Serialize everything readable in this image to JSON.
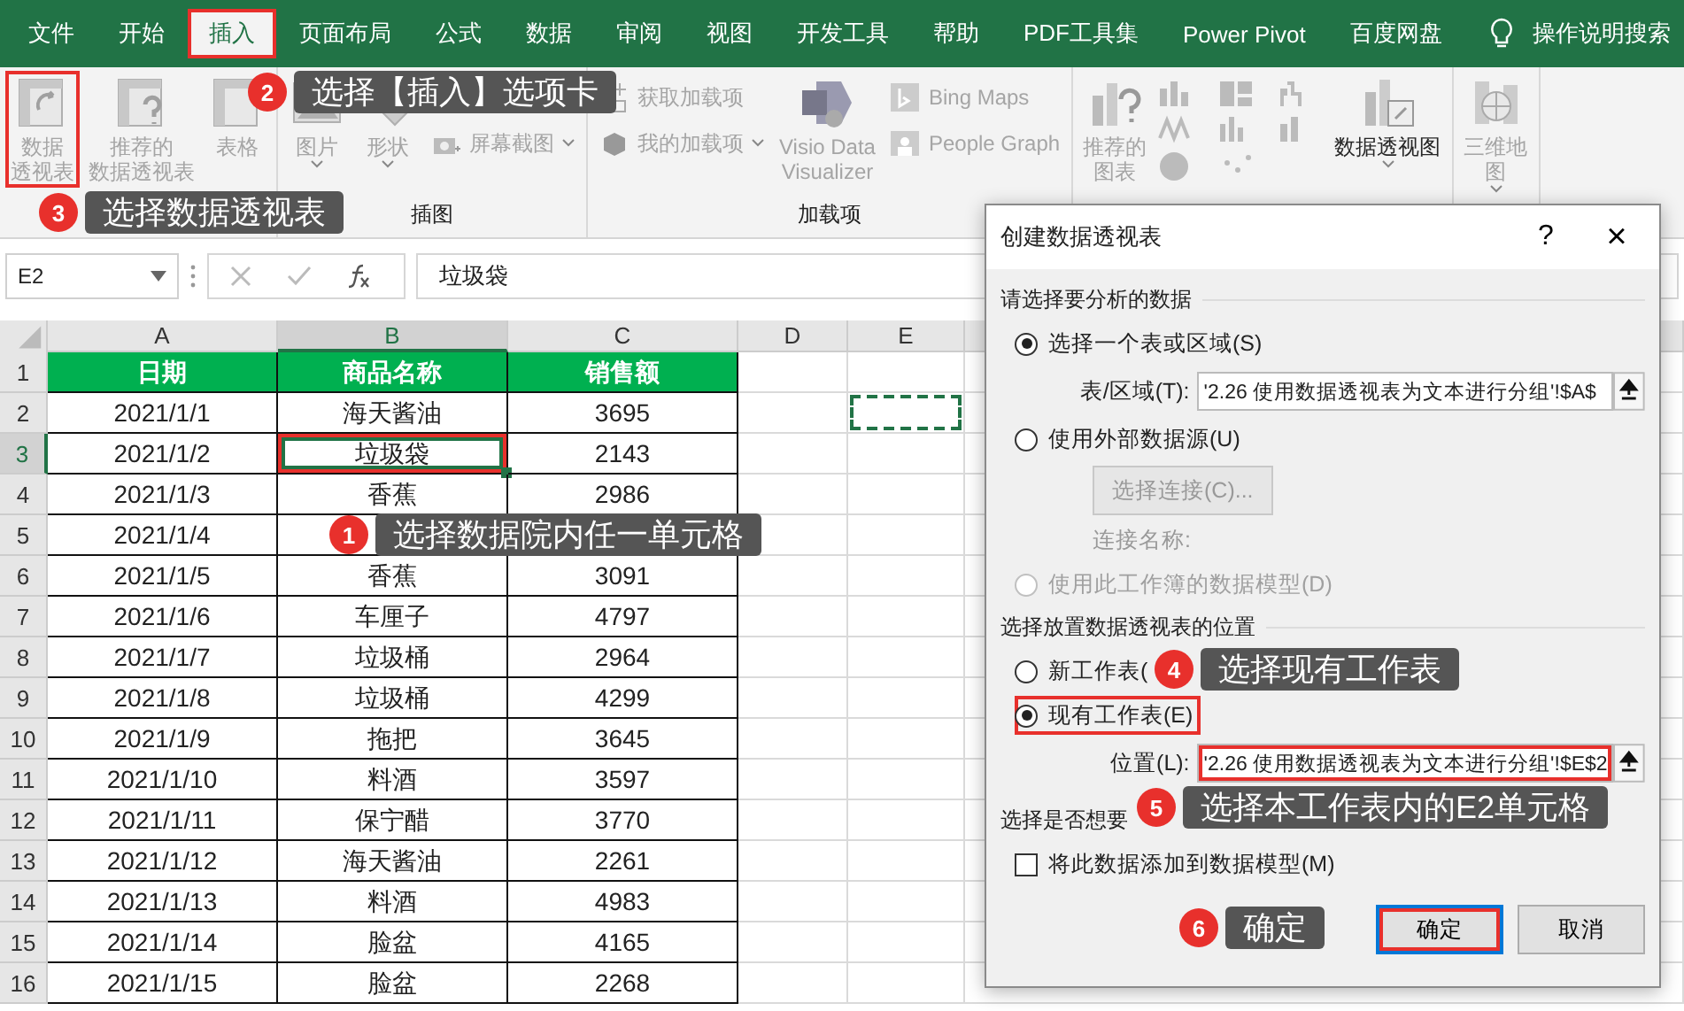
{
  "menu": {
    "tabs": [
      {
        "label": "文件",
        "selected": false
      },
      {
        "label": "开始",
        "selected": false
      },
      {
        "label": "插入",
        "selected": true,
        "highlighted": true
      },
      {
        "label": "页面布局",
        "selected": false
      },
      {
        "label": "公式",
        "selected": false
      },
      {
        "label": "数据",
        "selected": false
      },
      {
        "label": "审阅",
        "selected": false
      },
      {
        "label": "视图",
        "selected": false
      },
      {
        "label": "开发工具",
        "selected": false
      },
      {
        "label": "帮助",
        "selected": false
      },
      {
        "label": "PDF工具集",
        "selected": false
      },
      {
        "label": "Power Pivot",
        "selected": false
      },
      {
        "label": "百度网盘",
        "selected": false
      }
    ],
    "search": "操作说明搜索"
  },
  "ribbon": {
    "groups": [
      {
        "columns": [
          {
            "kind": "large",
            "lines": [
              "数据",
              "透视表"
            ],
            "disabled": true,
            "highlighted": true
          },
          {
            "kind": "large",
            "lines": [
              "推荐的",
              "数据透视表"
            ],
            "disabled": true
          },
          {
            "kind": "large",
            "lines": [
              "表格"
            ],
            "disabled": true
          }
        ]
      },
      {
        "label": "插图",
        "columns": [
          {
            "kind": "large",
            "lines": [
              "图片"
            ],
            "disabled": true,
            "caret": true
          },
          {
            "kind": "large",
            "lines": [
              "形状"
            ],
            "disabled": true,
            "caret": true
          },
          {
            "kind": "stack",
            "items": [
              {
                "label": "屏幕截图",
                "disabled": true,
                "caret": true
              }
            ]
          }
        ]
      },
      {
        "label": "加载项",
        "columns": [
          {
            "kind": "stack",
            "items": [
              {
                "label": "获取加载项",
                "disabled": true
              },
              {
                "label": "我的加载项",
                "disabled": true,
                "caret": true
              }
            ]
          },
          {
            "kind": "large",
            "lines": [
              "Visio Data",
              "Visualizer"
            ],
            "disabled": true
          },
          {
            "kind": "stack",
            "items": [
              {
                "label": "Bing Maps",
                "disabled": true
              },
              {
                "label": "People Graph",
                "disabled": true
              }
            ]
          }
        ]
      },
      {
        "columns": [
          {
            "kind": "large",
            "lines": [
              "推荐的",
              "图表"
            ],
            "disabled": true
          },
          {
            "kind": "charts"
          },
          {
            "kind": "large",
            "lines": [
              "数据透视图"
            ],
            "disabled": false,
            "caret": true
          }
        ]
      },
      {
        "columns": [
          {
            "kind": "large",
            "lines": [
              "三维地",
              "图"
            ],
            "disabled": true,
            "caret": true
          }
        ]
      }
    ]
  },
  "formula_bar": {
    "name_box": "E2",
    "value": "垃圾袋"
  },
  "sheet": {
    "columns": [
      {
        "label": "A",
        "selected": false
      },
      {
        "label": "B",
        "selected": true
      },
      {
        "label": "C",
        "selected": false
      },
      {
        "label": "D",
        "selected": false
      },
      {
        "label": "E",
        "selected": false
      }
    ],
    "rows": [
      {
        "number": "1",
        "kind": "header",
        "selected": false,
        "marquee": false,
        "cells": [
          {
            "text": "日期",
            "selected": false
          },
          {
            "text": "商品名称",
            "selected": false
          },
          {
            "text": "销售额",
            "selected": false
          }
        ]
      },
      {
        "number": "2",
        "kind": "data",
        "selected": false,
        "marquee": true,
        "cells": [
          {
            "text": "2021/1/1",
            "selected": false
          },
          {
            "text": "海天酱油",
            "selected": false
          },
          {
            "text": "3695",
            "selected": false
          }
        ]
      },
      {
        "number": "3",
        "kind": "data",
        "selected": true,
        "marquee": false,
        "cells": [
          {
            "text": "2021/1/2",
            "selected": false
          },
          {
            "text": "垃圾袋",
            "selected": true,
            "highlighted": true
          },
          {
            "text": "2143",
            "selected": false
          }
        ]
      },
      {
        "number": "4",
        "kind": "data",
        "selected": false,
        "marquee": false,
        "cells": [
          {
            "text": "2021/1/3",
            "selected": false
          },
          {
            "text": "香蕉",
            "selected": false
          },
          {
            "text": "2986",
            "selected": false
          }
        ]
      },
      {
        "number": "5",
        "kind": "data",
        "selected": false,
        "marquee": false,
        "cells": [
          {
            "text": "2021/1/4",
            "selected": false
          }
        ]
      },
      {
        "number": "6",
        "kind": "data",
        "selected": false,
        "marquee": false,
        "cells": [
          {
            "text": "2021/1/5",
            "selected": false
          },
          {
            "text": "香蕉",
            "selected": false
          },
          {
            "text": "3091",
            "selected": false
          }
        ]
      },
      {
        "number": "7",
        "kind": "data",
        "selected": false,
        "marquee": false,
        "cells": [
          {
            "text": "2021/1/6",
            "selected": false
          },
          {
            "text": "车厘子",
            "selected": false
          },
          {
            "text": "4797",
            "selected": false
          }
        ]
      },
      {
        "number": "8",
        "kind": "data",
        "selected": false,
        "marquee": false,
        "cells": [
          {
            "text": "2021/1/7",
            "selected": false
          },
          {
            "text": "垃圾桶",
            "selected": false
          },
          {
            "text": "2964",
            "selected": false
          }
        ]
      },
      {
        "number": "9",
        "kind": "data",
        "selected": false,
        "marquee": false,
        "cells": [
          {
            "text": "2021/1/8",
            "selected": false
          },
          {
            "text": "垃圾桶",
            "selected": false
          },
          {
            "text": "4299",
            "selected": false
          }
        ]
      },
      {
        "number": "10",
        "kind": "data",
        "selected": false,
        "marquee": false,
        "cells": [
          {
            "text": "2021/1/9",
            "selected": false
          },
          {
            "text": "拖把",
            "selected": false
          },
          {
            "text": "3645",
            "selected": false
          }
        ]
      },
      {
        "number": "11",
        "kind": "data",
        "selected": false,
        "marquee": false,
        "cells": [
          {
            "text": "2021/1/10",
            "selected": false
          },
          {
            "text": "料酒",
            "selected": false
          },
          {
            "text": "3597",
            "selected": false
          }
        ]
      },
      {
        "number": "12",
        "kind": "data",
        "selected": false,
        "marquee": false,
        "cells": [
          {
            "text": "2021/1/11",
            "selected": false
          },
          {
            "text": "保宁醋",
            "selected": false
          },
          {
            "text": "3770",
            "selected": false
          }
        ]
      },
      {
        "number": "13",
        "kind": "data",
        "selected": false,
        "marquee": false,
        "cells": [
          {
            "text": "2021/1/12",
            "selected": false
          },
          {
            "text": "海天酱油",
            "selected": false
          },
          {
            "text": "2261",
            "selected": false
          }
        ]
      },
      {
        "number": "14",
        "kind": "data",
        "selected": false,
        "marquee": false,
        "cells": [
          {
            "text": "2021/1/13",
            "selected": false
          },
          {
            "text": "料酒",
            "selected": false
          },
          {
            "text": "4983",
            "selected": false
          }
        ]
      },
      {
        "number": "15",
        "kind": "data",
        "selected": false,
        "marquee": false,
        "cells": [
          {
            "text": "2021/1/14",
            "selected": false
          },
          {
            "text": "脸盆",
            "selected": false
          },
          {
            "text": "4165",
            "selected": false
          }
        ]
      },
      {
        "number": "16",
        "kind": "data",
        "selected": false,
        "marquee": false,
        "cells": [
          {
            "text": "2021/1/15",
            "selected": false
          },
          {
            "text": "脸盆",
            "selected": false
          },
          {
            "text": "2268",
            "selected": false
          }
        ]
      }
    ]
  },
  "dialog": {
    "title": "创建数据透视表",
    "help": "?",
    "close": "×",
    "source": {
      "heading": "请选择要分析的数据",
      "options": [
        {
          "label": "选择一个表或区域(S)",
          "selected": true,
          "disabled": false
        },
        {
          "label": "使用外部数据源(U)",
          "selected": false,
          "disabled": false
        },
        {
          "label": "使用此工作簿的数据模型(D)",
          "selected": false,
          "disabled": true
        }
      ],
      "range_label": "表/区域(T):",
      "range_value": "'2.26 使用数据透视表为文本进行分组'!$A$",
      "connect_button": "选择连接(C)...",
      "connection_label": "连接名称:"
    },
    "location": {
      "heading": "选择放置数据透视表的位置",
      "options": [
        {
          "label": "新工作表(",
          "selected": false,
          "highlighted": false
        },
        {
          "label": "现有工作表(E)",
          "selected": true,
          "highlighted": true
        }
      ],
      "field_label": "位置(L):",
      "field_value": "'2.26 使用数据透视表为文本进行分组'!$E$2",
      "field_highlighted": true
    },
    "model": {
      "heading": "选择是否想要",
      "checkbox": {
        "label": "将此数据添加到数据模型(M)",
        "checked": false
      }
    },
    "buttons": [
      {
        "label": "确定",
        "default": true,
        "highlighted": true
      },
      {
        "label": "取消",
        "default": false,
        "highlighted": false
      }
    ]
  },
  "callouts": [
    {
      "number": "1",
      "text": "选择数据院内任一单元格"
    },
    {
      "number": "2",
      "text": "选择【插入】选项卡"
    },
    {
      "number": "3",
      "text": "选择数据透视表"
    },
    {
      "number": "4",
      "text": "选择现有工作表"
    },
    {
      "number": "5",
      "text": "选择本工作表内的E2单元格"
    },
    {
      "number": "6",
      "text": "确定"
    }
  ]
}
